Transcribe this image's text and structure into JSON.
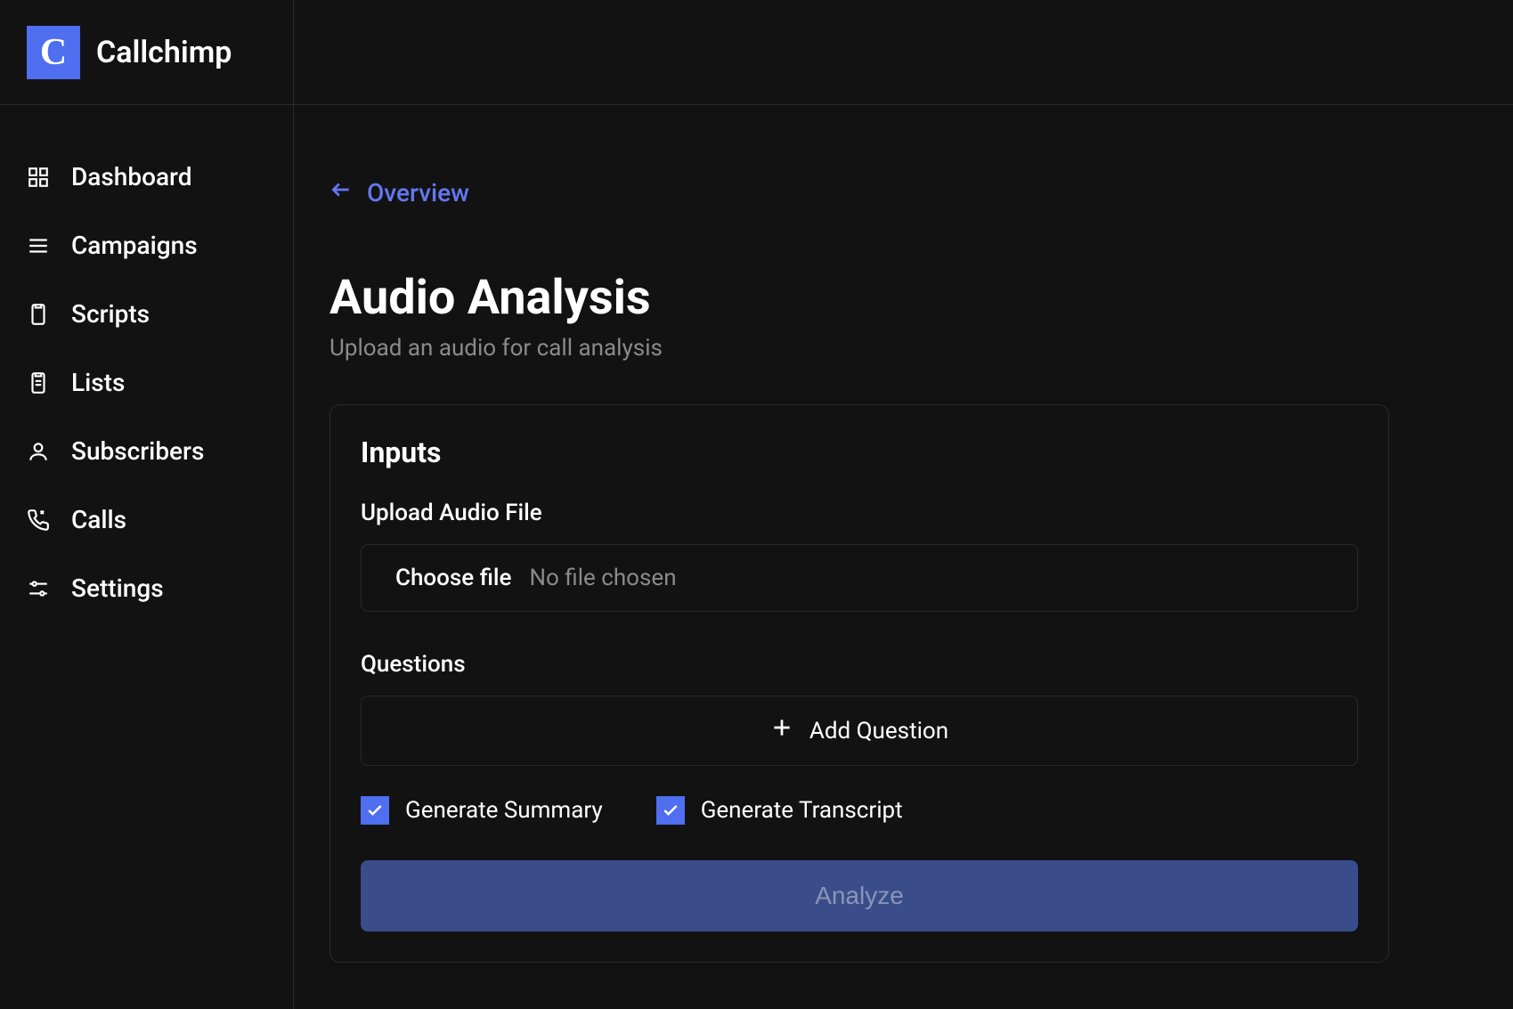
{
  "brand": {
    "logo_letter": "C",
    "name": "Callchimp"
  },
  "sidebar": {
    "items": [
      {
        "label": "Dashboard",
        "icon": "dashboard-icon"
      },
      {
        "label": "Campaigns",
        "icon": "campaigns-icon"
      },
      {
        "label": "Scripts",
        "icon": "scripts-icon"
      },
      {
        "label": "Lists",
        "icon": "lists-icon"
      },
      {
        "label": "Subscribers",
        "icon": "subscribers-icon"
      },
      {
        "label": "Calls",
        "icon": "calls-icon"
      },
      {
        "label": "Settings",
        "icon": "settings-icon"
      }
    ]
  },
  "main": {
    "back_link": "Overview",
    "title": "Audio Analysis",
    "subtitle": "Upload an audio for call analysis",
    "card": {
      "title": "Inputs",
      "upload_label": "Upload Audio File",
      "file_choose": "Choose file",
      "file_status": "No file chosen",
      "questions_label": "Questions",
      "add_question_label": "Add Question",
      "checkbox_summary": "Generate Summary",
      "checkbox_transcript": "Generate Transcript",
      "analyze_button": "Analyze"
    }
  },
  "colors": {
    "accent": "#4f6ef0",
    "link": "#6378f0",
    "border": "#2a2a2a",
    "muted": "#8a8a8a",
    "analyze_bg": "#3a4d8a",
    "analyze_fg": "#8a95b8"
  }
}
